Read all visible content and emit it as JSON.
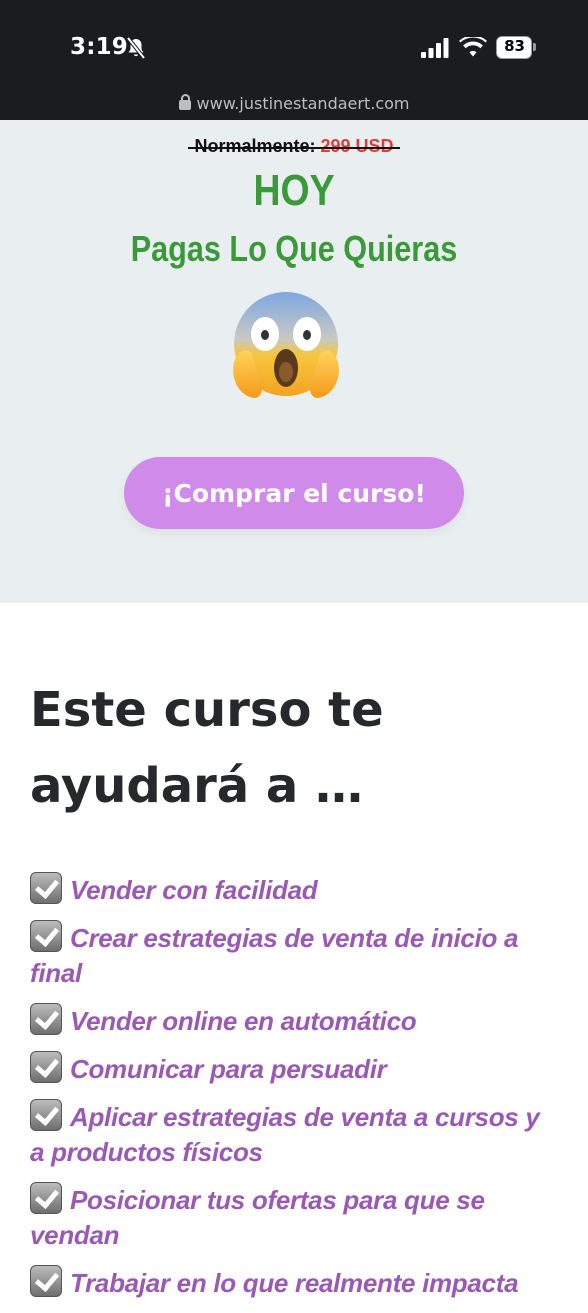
{
  "status_bar": {
    "time": "3:19",
    "battery": "83"
  },
  "browser": {
    "url": "www.justinestandaert.com"
  },
  "hero": {
    "normal_label": "Normalmente:",
    "normal_price": "299 USD",
    "today": "HOY",
    "offer": "Pagas Lo Que Quieras",
    "emoji": "face-screaming-in-fear",
    "cta_label": "¡Comprar el curso!",
    "background_color": "#e9eff0",
    "accent_green": "#3a9a3a",
    "cta_color": "#cf8aea"
  },
  "benefits": {
    "heading": "Este curso te ayudará a …",
    "items": [
      "Vender con facilidad",
      "Crear estrategias de venta de inicio a final",
      "Vender online en automático",
      "Comunicar para persuadir",
      "Aplicar estrategias de venta a cursos y a productos físicos",
      "Posicionar tus ofertas para que se vendan",
      "Trabajar en lo que realmente impacta"
    ],
    "item_color": "#9b59b6"
  }
}
